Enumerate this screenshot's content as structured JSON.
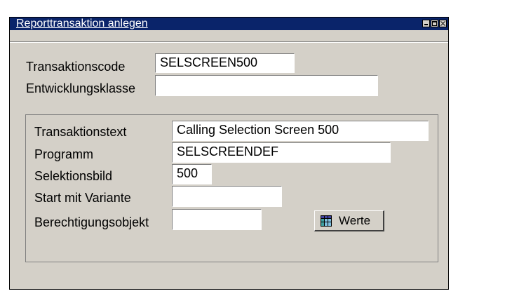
{
  "window": {
    "title": "Reporttransaktion anlegen",
    "title_bar_color": "#0a246a",
    "background_color": "#d4d0c8"
  },
  "header_fields": {
    "transaction_code": {
      "label": "Transaktionscode",
      "value": "SELSCREEN500"
    },
    "dev_class": {
      "label": "Entwicklungsklasse",
      "value": ""
    }
  },
  "details": {
    "transaction_text": {
      "label": "Transaktionstext",
      "value": "Calling Selection Screen 500"
    },
    "program": {
      "label": "Programm",
      "value": "SELSCREENDEF"
    },
    "selection_screen": {
      "label": "Selektionsbild",
      "value": "500"
    },
    "start_variant": {
      "label": "Start mit Variante",
      "value": ""
    },
    "auth_object": {
      "label": "Berechtigungsobjekt",
      "value": ""
    },
    "values_button": {
      "label": "Werte",
      "icon": "table-icon"
    }
  }
}
